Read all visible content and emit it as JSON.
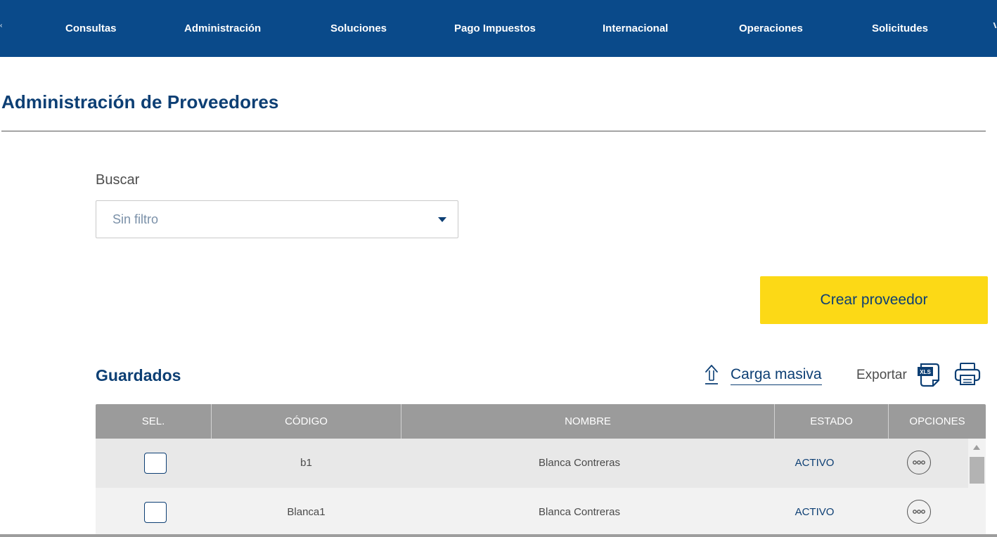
{
  "nav": {
    "items": [
      {
        "label": "Consultas"
      },
      {
        "label": "Administración"
      },
      {
        "label": "Soluciones"
      },
      {
        "label": "Pago Impuestos"
      },
      {
        "label": "Internacional"
      },
      {
        "label": "Operaciones"
      },
      {
        "label": "Solicitudes"
      }
    ]
  },
  "page": {
    "title": "Administración de Proveedores"
  },
  "search": {
    "label": "Buscar",
    "selected_value": "Sin filtro"
  },
  "actions": {
    "create_label": "Crear proveedor",
    "bulk_upload_label": "Carga masiva",
    "export_label": "Exportar",
    "xls_text": "XLS"
  },
  "saved": {
    "title": "Guardados",
    "columns": [
      "SEL.",
      "CÓDIGO",
      "NOMBRE",
      "ESTADO",
      "OPCIONES"
    ],
    "rows": [
      {
        "code": "b1",
        "name": "Blanca Contreras",
        "status": "ACTIVO"
      },
      {
        "code": "Blanca1",
        "name": "Blanca Contreras",
        "status": "ACTIVO"
      }
    ]
  },
  "colors": {
    "nav_bg": "#0a4a8a",
    "brand_dark": "#0d3f74",
    "accent_yellow": "#fcd916",
    "table_header": "#9b9b9b"
  },
  "icons": {
    "upload": "upload-arrow-icon",
    "xls": "xls-file-icon",
    "print": "printer-icon",
    "options": "more-options-icon",
    "dropdown": "chevron-down-icon"
  }
}
